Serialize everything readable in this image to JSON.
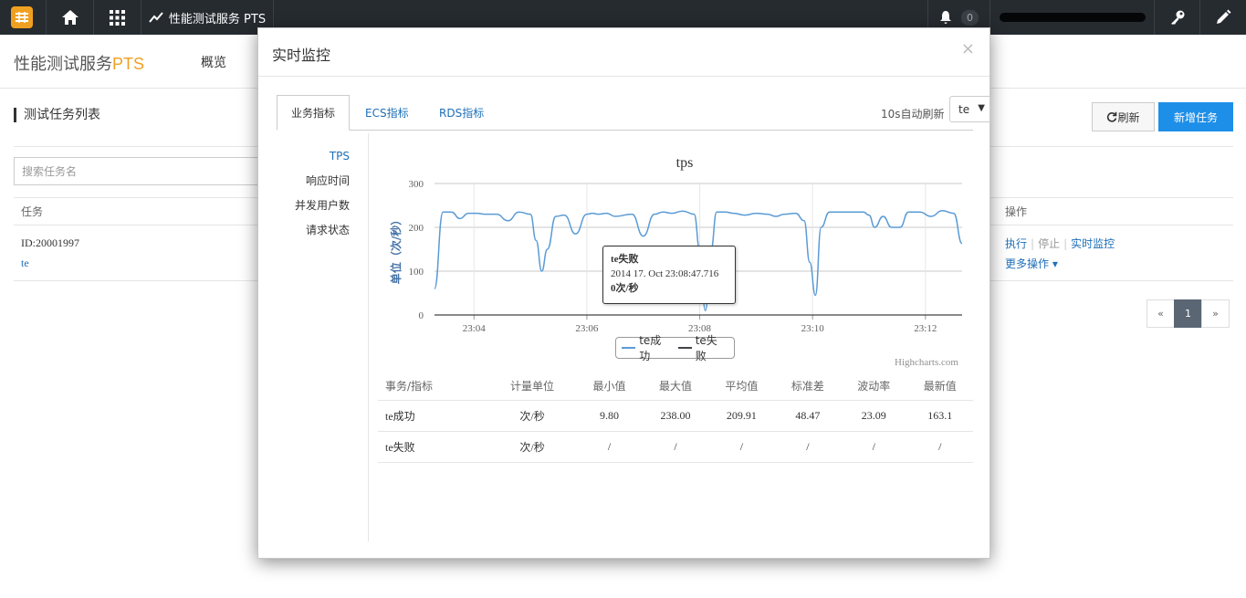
{
  "topbar": {
    "product_label": "性能测试服务 PTS",
    "notification_count": "0"
  },
  "header": {
    "brand_main": "性能测试服务",
    "brand_accent": "PTS",
    "nav_overview": "概览"
  },
  "page": {
    "section_title": "测试任务列表",
    "refresh_label": "刷新",
    "new_task_label": "新增任务",
    "search_placeholder": "搜索任务名",
    "col_task": "任务",
    "col_ops": "操作",
    "task": {
      "id": "ID:20001997",
      "name": "te"
    },
    "ops": {
      "run": "执行",
      "stop": "停止",
      "monitor": "实时监控",
      "more": "更多操作"
    },
    "pager": {
      "prev": "«",
      "current": "1",
      "next": "»"
    }
  },
  "modal": {
    "title": "实时监控",
    "close": "×",
    "tabs": [
      "业务指标",
      "ECS指标",
      "RDS指标"
    ],
    "auto_refresh": "10s自动刷新",
    "select_value": "te",
    "side_menu": [
      "TPS",
      "响应时间",
      "并发用户数",
      "请求状态"
    ],
    "credit": "Highcharts.com",
    "tooltip": {
      "series": "te失败",
      "time": "2014 17. Oct 23:08:47.716",
      "value": "0次/秒"
    },
    "stats": {
      "headers": [
        "事务/指标",
        "计量单位",
        "最小值",
        "最大值",
        "平均值",
        "标准差",
        "波动率",
        "最新值"
      ],
      "rows": [
        [
          "te成功",
          "次/秒",
          "9.80",
          "238.00",
          "209.91",
          "48.47",
          "23.09",
          "163.1"
        ],
        [
          "te失败",
          "次/秒",
          "/",
          "/",
          "/",
          "/",
          "/",
          "/"
        ]
      ]
    }
  },
  "chart_data": {
    "type": "line",
    "title": "tps",
    "ylabel": "单位（次/秒）",
    "ylim": [
      0,
      300
    ],
    "yticks": [
      "0",
      "100",
      "200",
      "300"
    ],
    "xticks": [
      "23:04",
      "23:06",
      "23:08",
      "23:10",
      "23:12"
    ],
    "xlim_minutes": [
      3.3,
      12.65
    ],
    "series": [
      {
        "name": "te成功",
        "color": "#5b9bd5",
        "x_minutes": [
          3.3,
          3.45,
          3.6,
          3.75,
          3.9,
          4.05,
          4.2,
          4.4,
          4.6,
          4.8,
          5.0,
          5.1,
          5.2,
          5.3,
          5.45,
          5.6,
          5.8,
          6.0,
          6.1,
          6.2,
          6.35,
          6.5,
          6.8,
          7.0,
          7.2,
          7.35,
          7.5,
          7.7,
          7.9,
          8.0,
          8.1,
          8.2,
          8.3,
          8.45,
          8.6,
          8.8,
          9.0,
          9.2,
          9.35,
          9.5,
          9.7,
          9.85,
          9.95,
          10.05,
          10.15,
          10.3,
          10.6,
          10.9,
          11.0,
          11.1,
          11.25,
          11.4,
          11.55,
          11.7,
          11.9,
          12.1,
          12.3,
          12.5,
          12.65
        ],
        "values": [
          60,
          235,
          235,
          220,
          232,
          232,
          230,
          230,
          215,
          235,
          230,
          170,
          100,
          150,
          225,
          228,
          185,
          230,
          232,
          230,
          232,
          225,
          230,
          180,
          230,
          235,
          232,
          237,
          230,
          150,
          10,
          150,
          235,
          235,
          232,
          228,
          232,
          230,
          225,
          230,
          232,
          215,
          120,
          45,
          200,
          235,
          235,
          235,
          228,
          200,
          225,
          200,
          200,
          235,
          235,
          225,
          238,
          232,
          163
        ]
      },
      {
        "name": "te失败",
        "color": "#434348",
        "x_minutes": [
          3.3,
          12.65
        ],
        "values": [
          0,
          0
        ]
      }
    ]
  }
}
